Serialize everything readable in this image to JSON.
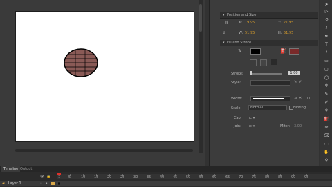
{
  "properties": {
    "position_size": {
      "header": "Position and Size",
      "x_label": "X:",
      "x_value": "19.95",
      "y_label": "Y:",
      "y_value": "71.95",
      "w_label": "W:",
      "w_value": "51.95",
      "h_label": "H:",
      "h_value": "51.95"
    },
    "fill_stroke": {
      "header": "Fill and Stroke",
      "stroke_label": "Stroke:",
      "stroke_value": "1.00",
      "style_label": "Style:",
      "width_label": "Width:",
      "scale_label": "Scale:",
      "scale_value": "Normal",
      "hinting_label": "Hinting",
      "cap_label": "Cap:",
      "join_label": "Join:",
      "miter_label": "Miter:",
      "miter_value": "3.00"
    }
  },
  "timeline": {
    "tabs": [
      "Timeline",
      "Output"
    ],
    "layer_name": "Layer 1",
    "frame_numbers": [
      "1",
      "5",
      "10",
      "15",
      "20",
      "25",
      "30",
      "35",
      "40",
      "45",
      "50",
      "55",
      "60",
      "65",
      "70",
      "75",
      "80",
      "85",
      "90",
      "95"
    ]
  },
  "colors": {
    "shape_fill": "#8a5a56",
    "stroke_color": "#000000",
    "fill_color": "#7a2a2a",
    "accent": "#d39a2b"
  }
}
